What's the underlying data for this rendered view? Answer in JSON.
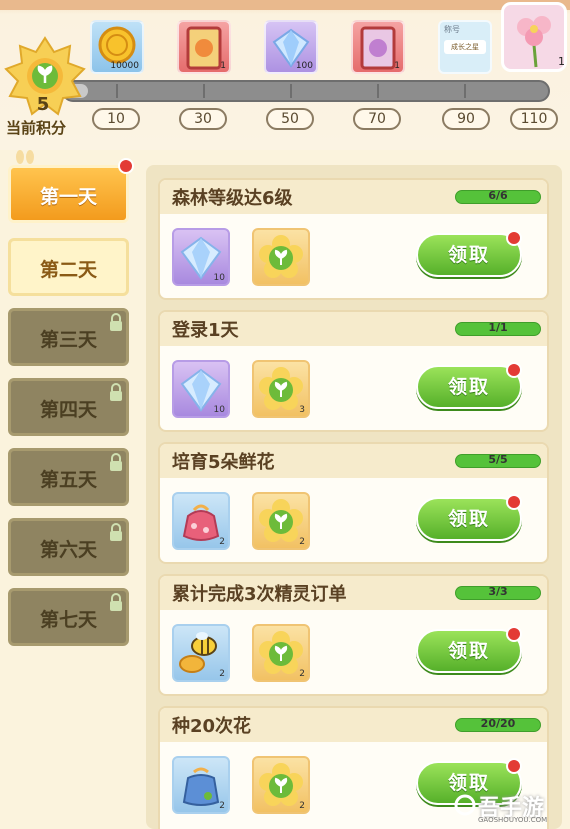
{
  "top_rewards": {
    "score_value": "5",
    "score_label": "当前积分",
    "progress": {
      "current": 5,
      "max": 110
    },
    "milestones": [
      "10",
      "30",
      "50",
      "70",
      "90",
      "110"
    ],
    "rewards": [
      {
        "name": "gold-coin-icon",
        "qty": "10000"
      },
      {
        "name": "card-pack-icon",
        "qty": "1"
      },
      {
        "name": "diamond-icon",
        "qty": "100"
      },
      {
        "name": "card-pack-icon",
        "qty": "1"
      },
      {
        "name": "title-card-icon",
        "label_top": "称号",
        "label": "成长之星",
        "qty": ""
      },
      {
        "name": "flower-icon",
        "qty": "1"
      }
    ]
  },
  "days": [
    {
      "label": "第一天",
      "state": "active",
      "red_dot": true
    },
    {
      "label": "第二天",
      "state": "open",
      "red_dot": false
    },
    {
      "label": "第三天",
      "state": "locked",
      "red_dot": false
    },
    {
      "label": "第四天",
      "state": "locked",
      "red_dot": false
    },
    {
      "label": "第五天",
      "state": "locked",
      "red_dot": false
    },
    {
      "label": "第六天",
      "state": "locked",
      "red_dot": false
    },
    {
      "label": "第七天",
      "state": "locked",
      "red_dot": false
    }
  ],
  "tasks": [
    {
      "title": "森林等级达6级",
      "progress": "6/6",
      "item1": {
        "icon": "diamond-icon",
        "qty": "10"
      },
      "item2": {
        "icon": "score-flower-icon",
        "qty": ""
      },
      "claim": "领取"
    },
    {
      "title": "登录1天",
      "progress": "1/1",
      "item1": {
        "icon": "diamond-icon",
        "qty": "10"
      },
      "item2": {
        "icon": "score-flower-icon",
        "qty": "3"
      },
      "claim": "领取"
    },
    {
      "title": "培育5朵鲜花",
      "progress": "5/5",
      "item1": {
        "icon": "gift-bag-icon",
        "qty": "2"
      },
      "item2": {
        "icon": "score-flower-icon",
        "qty": "2"
      },
      "claim": "领取"
    },
    {
      "title": "累计完成3次精灵订单",
      "progress": "3/3",
      "item1": {
        "icon": "bee-honey-icon",
        "qty": "2"
      },
      "item2": {
        "icon": "score-flower-icon",
        "qty": "2"
      },
      "claim": "领取"
    },
    {
      "title": "种20次花",
      "progress": "20/20",
      "item1": {
        "icon": "seed-bag-icon",
        "qty": "2"
      },
      "item2": {
        "icon": "score-flower-icon",
        "qty": "2"
      },
      "claim": "领取"
    }
  ],
  "watermark": {
    "text": "吾手游",
    "sub": "GAOSHOUYOU.COM"
  }
}
